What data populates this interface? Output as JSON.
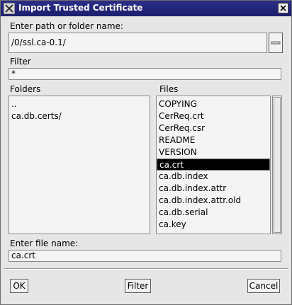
{
  "window": {
    "title": "Import Trusted Certificate",
    "title_icon": "app-icon",
    "close_icon": "close-icon"
  },
  "path": {
    "label": "Enter path or folder name:",
    "value": "/0/ssl.ca-0.1/",
    "dropdown_icon": "dropdown-icon"
  },
  "filter": {
    "label": "Filter",
    "value": "*"
  },
  "folders": {
    "label": "Folders",
    "items": [
      "..",
      "ca.db.certs/"
    ]
  },
  "files": {
    "label": "Files",
    "items": [
      "COPYING",
      "CerReq.crt",
      "CerReq.csr",
      "README",
      "VERSION",
      "ca.crt",
      "ca.db.index",
      "ca.db.index.attr",
      "ca.db.index.attr.old",
      "ca.db.serial",
      "ca.key"
    ],
    "selected": "ca.crt"
  },
  "filename": {
    "label": "Enter file name:",
    "value": "ca.crt"
  },
  "buttons": {
    "ok": "OK",
    "filter": "Filter",
    "cancel": "Cancel"
  },
  "colors": {
    "titlebar": "#1c1f6e",
    "background": "#e6e6e6",
    "selection": "#000000"
  }
}
